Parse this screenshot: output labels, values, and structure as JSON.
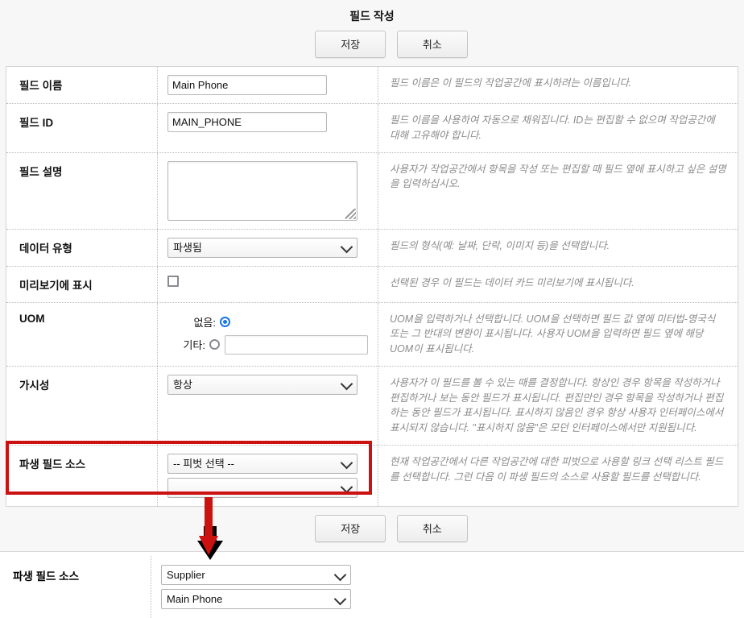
{
  "panel": {
    "title": "필드 작성",
    "save_label": "저장",
    "cancel_label": "취소",
    "save_label_bottom": "저장",
    "cancel_label_bottom": "취소"
  },
  "rows": {
    "field_name": {
      "label": "필드 이름",
      "value": "Main Phone",
      "help": "필드 이름은 이 필드의 작업공간에 표시하려는 이름입니다."
    },
    "field_id": {
      "label": "필드 ID",
      "value": "MAIN_PHONE",
      "help": "필드 이름을 사용하여 자동으로 채워집니다. ID는 편집할 수 없으며 작업공간에 대해 고유해야 합니다."
    },
    "field_description": {
      "label": "필드 설명",
      "value": "",
      "help": "사용자가 작업공간에서 항목을 작성 또는 편집할 때 필드 옆에 표시하고 싶은 설명을 입력하십시오."
    },
    "data_type": {
      "label": "데이터 유형",
      "value": "파생됨",
      "help": "필드의 형식(예: 날짜, 단락, 이미지 등)을 선택합니다."
    },
    "show_in_preview": {
      "label": "미리보기에 표시",
      "checked": false,
      "help": "선택된 경우 이 필드는 데이터 카드 미리보기에 표시됩니다."
    },
    "uom": {
      "label": "UOM",
      "none_label": "없음:",
      "other_label": "기타:",
      "none_selected": true,
      "other_value": "",
      "help": "UOM을 입력하거나 선택합니다. UOM을 선택하면 필드 값 옆에 미터법-영국식 또는 그 반대의 변환이 표시됩니다. 사용자 UOM을 입력하면 필드 옆에 해당 UOM이 표시됩니다."
    },
    "visibility": {
      "label": "가시성",
      "value": "항상",
      "help": "사용자가 이 필드를 볼 수 있는 때를 결정합니다. 항상인 경우 항목을 작성하거나 편집하거나 보는 동안 필드가 표시됩니다. 편집만인 경우 항목을 작성하거나 편집하는 동안 필드가 표시됩니다. 표시하지 않음인 경우 항상 사용자 인터페이스에서 표시되지 않습니다. \"표시하지 않음\"은 모던 인터페이스에서만 지원됩니다."
    },
    "derived_source": {
      "label": "파생 필드 소스",
      "pivot_value": "-- 피벗 선택 --",
      "field_value": "",
      "help": "현재 작업공간에서 다른 작업공간에 대한 피벗으로 사용할 링크 선택 리스트 필드를 선택합니다. 그런 다음 이 파생 필드의 소스로 사용할 필드를 선택합니다."
    }
  },
  "bottom": {
    "label": "파생 필드 소스",
    "pivot_value": "Supplier",
    "field_value": "Main Phone"
  },
  "colors": {
    "highlight": "#cc1111",
    "arrow": "#cc1111",
    "radio_accent": "#1a73e8"
  }
}
